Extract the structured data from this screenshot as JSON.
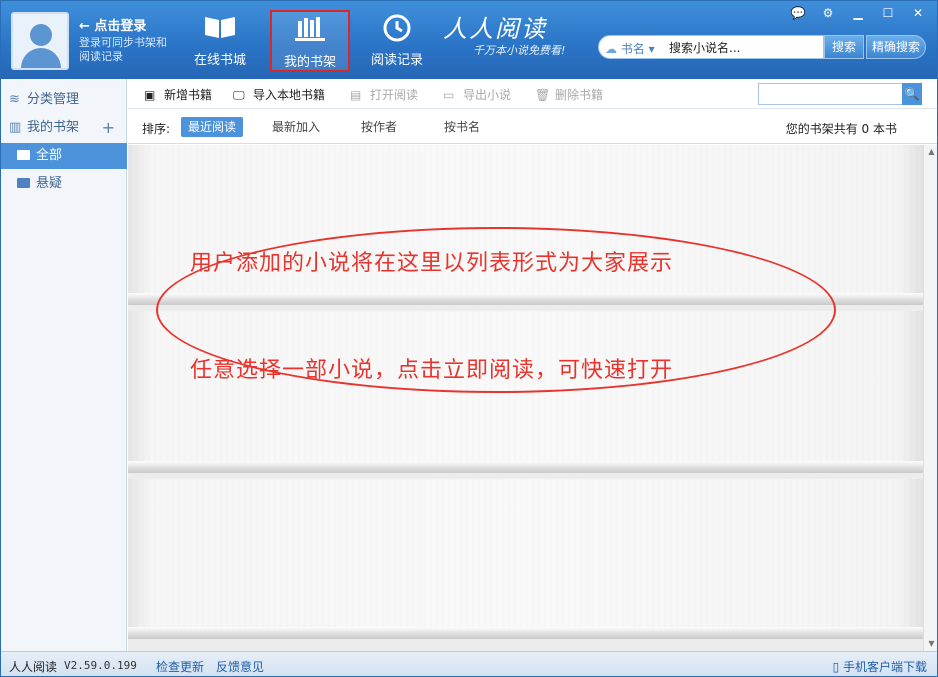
{
  "header": {
    "login_title": "← 点击登录",
    "login_sub": "登录可同步书架和阅读记录",
    "nav": [
      {
        "label": "在线书城",
        "icon": "book-open-icon"
      },
      {
        "label": "我的书架",
        "icon": "bookshelf-icon",
        "active": true
      },
      {
        "label": "阅读记录",
        "icon": "clock-icon"
      }
    ],
    "brand_title": "人人阅读",
    "brand_slogan": "千万本小说免费看!",
    "search": {
      "type_label": "书名",
      "placeholder": "搜索小说名...",
      "search_button": "搜索",
      "precise_button": "精确搜索"
    },
    "window_controls": [
      "chat-icon",
      "gear-icon",
      "minimize-icon",
      "maximize-icon",
      "close-icon"
    ]
  },
  "sidebar": {
    "category_manage": "分类管理",
    "my_shelf": "我的书架",
    "add": "+",
    "folders": [
      {
        "label": "全部",
        "selected": true
      },
      {
        "label": "悬疑",
        "selected": false
      }
    ]
  },
  "toolbar": {
    "add_book": "新增书籍",
    "import_local": "导入本地书籍",
    "open_read": "打开阅读",
    "export_novel": "导出小说",
    "delete_book": "删除书籍",
    "search_value": ""
  },
  "sortbar": {
    "label": "排序:",
    "options": [
      "最近阅读",
      "最新加入",
      "按作者",
      "按书名"
    ],
    "active_index": 0,
    "count_text": "您的书架共有 0 本书"
  },
  "shelf": {
    "line1": "用户添加的小说将在这里以列表形式为大家展示",
    "line2": "任意选择一部小说，点击立即阅读，可快速打开"
  },
  "statusbar": {
    "app_name": "人人阅读",
    "version": "V2.59.0.199",
    "check_update": "检查更新",
    "feedback": "反馈意见",
    "mobile_download": "手机客户端下载"
  },
  "colors": {
    "accent": "#2a73c6",
    "annotation_red": "#e8342d",
    "selected": "#4d93db"
  }
}
